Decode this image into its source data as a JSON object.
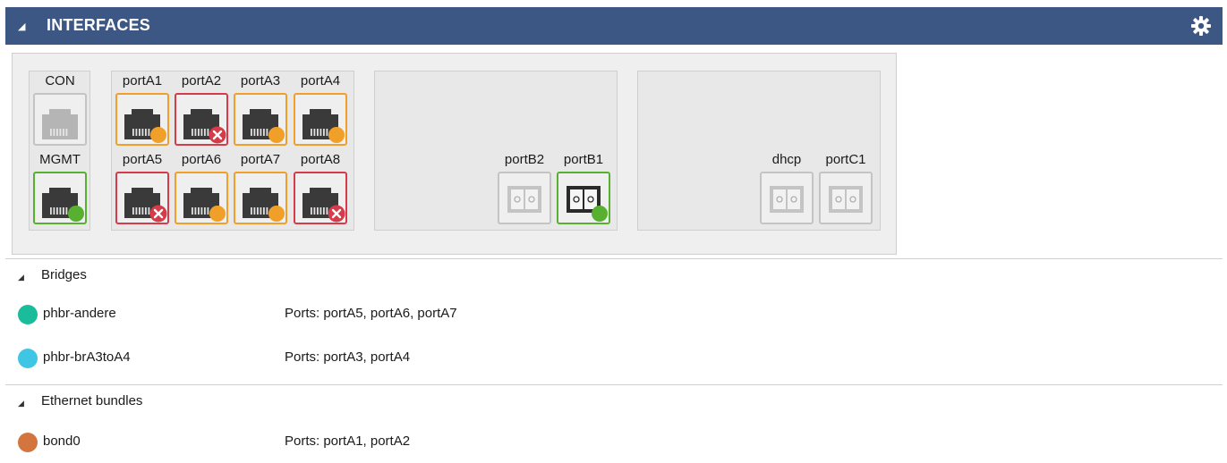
{
  "header": {
    "title": "INTERFACES",
    "collapse_icon": "triangle-down-icon",
    "settings_icon": "gear-icon",
    "background_color": "#3d5785"
  },
  "interfaces": {
    "status_colors": {
      "up": "#58b030",
      "warning": "#f0a028",
      "error": "#d63b4a",
      "inactive": "#c4c4c4"
    },
    "console": {
      "label": "CON",
      "state": "inactive"
    },
    "management": {
      "label": "MGMT",
      "state": "up"
    },
    "group_a": [
      {
        "label": "portA1",
        "state": "warning"
      },
      {
        "label": "portA2",
        "state": "error"
      },
      {
        "label": "portA3",
        "state": "warning"
      },
      {
        "label": "portA4",
        "state": "warning"
      },
      {
        "label": "portA5",
        "state": "error"
      },
      {
        "label": "portA6",
        "state": "warning"
      },
      {
        "label": "portA7",
        "state": "warning"
      },
      {
        "label": "portA8",
        "state": "error"
      }
    ],
    "group_b": [
      {
        "label": "portB2",
        "state": "inactive",
        "kind": "fiber"
      },
      {
        "label": "portB1",
        "state": "up",
        "kind": "fiber"
      }
    ],
    "group_c": [
      {
        "label": "dhcp",
        "state": "inactive",
        "kind": "fiber"
      },
      {
        "label": "portC1",
        "state": "inactive",
        "kind": "fiber"
      }
    ]
  },
  "bridges": {
    "title": "Bridges",
    "items": [
      {
        "name": "phbr-andere",
        "ports": "Ports:  portA5, portA6, portA7",
        "color": "#1bbc9b"
      },
      {
        "name": "phbr-brA3toA4",
        "ports": "Ports:  portA3, portA4",
        "color": "#3ec6e4"
      }
    ]
  },
  "bundles": {
    "title": "Ethernet bundles",
    "items": [
      {
        "name": "bond0",
        "ports": "Ports:  portA1, portA2",
        "color": "#d4743f"
      }
    ]
  }
}
